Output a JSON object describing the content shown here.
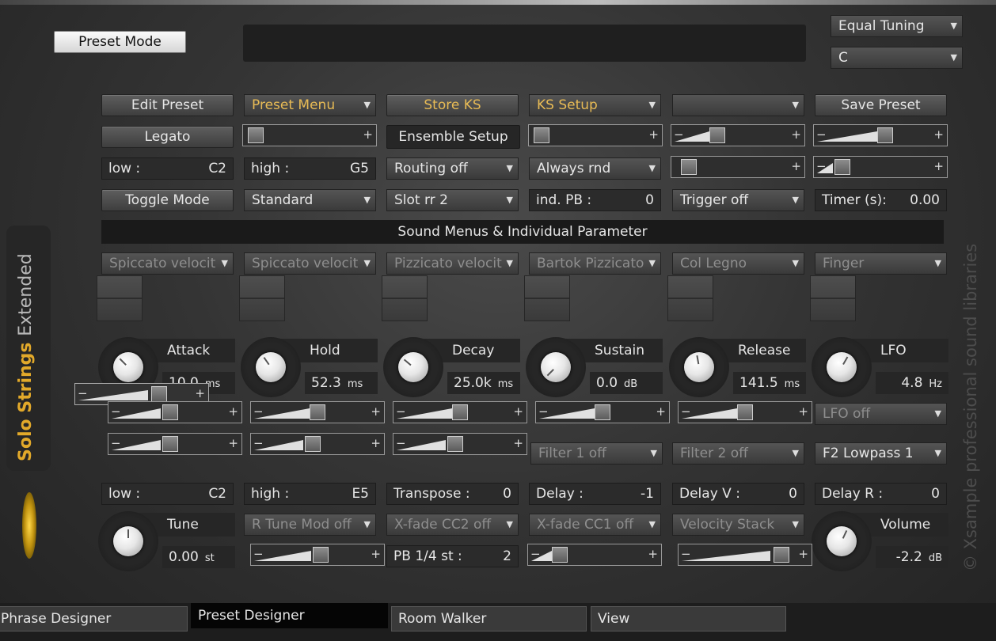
{
  "top": {
    "preset_mode": "Preset Mode",
    "tuning_menu": "Equal Tuning",
    "key_menu": "C"
  },
  "row1": {
    "edit_preset": "Edit Preset",
    "preset_menu": "Preset Menu",
    "store_ks": "Store KS",
    "ks_setup": "KS Setup",
    "blank_menu": "",
    "save_preset": "Save Preset"
  },
  "row2": {
    "legato": "Legato",
    "ensemble_setup": "Ensemble Setup"
  },
  "row3": {
    "low_label": "low :",
    "low_value": "C2",
    "high_label": "high :",
    "high_value": "G5",
    "routing": "Routing off",
    "always_rnd": "Always rnd"
  },
  "row4": {
    "toggle_mode": "Toggle Mode",
    "standard": "Standard",
    "slot_rr": "Slot rr 2",
    "ind_pb_label": "ind. PB :",
    "ind_pb_value": "0",
    "trigger": "Trigger off",
    "timer_label": "Timer (s):",
    "timer_value": "0.00"
  },
  "section_title": "Sound Menus & Individual Parameter",
  "sound_menus": [
    "Spiccato velocit",
    "Spiccato velocit",
    "Pizzicato velocit",
    "Bartok Pizzicato",
    "Col Legno",
    "Finger"
  ],
  "envelope": [
    {
      "label": "Attack",
      "value": "10.0",
      "unit": "ms"
    },
    {
      "label": "Hold",
      "value": "52.3",
      "unit": "ms"
    },
    {
      "label": "Decay",
      "value": "25.0k",
      "unit": "ms"
    },
    {
      "label": "Sustain",
      "value": "0.0",
      "unit": "dB"
    },
    {
      "label": "Release",
      "value": "141.5",
      "unit": "ms"
    },
    {
      "label": "LFO",
      "value": "4.8",
      "unit": "Hz"
    }
  ],
  "lfo_menu": "LFO off",
  "filter1": "Filter 1 off",
  "filter2": "Filter 2 off",
  "f2_type": "F2 Lowpass 1",
  "row_range": {
    "low_label": "low :",
    "low_value": "C2",
    "high_label": "high :",
    "high_value": "E5",
    "transpose_label": "Transpose :",
    "transpose_value": "0",
    "delay_label": "Delay :",
    "delay_value": "-1",
    "delay_v_label": "Delay V :",
    "delay_v_value": "0",
    "delay_r_label": "Delay R :",
    "delay_r_value": "0"
  },
  "tune": {
    "label": "Tune",
    "value": "0.00",
    "unit": "st"
  },
  "volume": {
    "label": "Volume",
    "value": "-2.2",
    "unit": "dB"
  },
  "bottom_menus": {
    "r_tune_mod": "R Tune Mod off",
    "xfade_cc2": "X-fade CC2 off",
    "xfade_cc1": "X-fade CC1 off",
    "velocity_stack": "Velocity Stack",
    "pb_label": "PB 1/4 st :",
    "pb_value": "2"
  },
  "side": {
    "brand_a": "Solo Strings",
    "brand_b": "Extended",
    "copyright": "© Xsample professional sound libraries"
  },
  "tabs": [
    "Phrase Designer",
    "Preset Designer",
    "Room Walker",
    "View"
  ],
  "colors": {
    "accent": "#e8bb55",
    "active_tab": "#050505"
  }
}
